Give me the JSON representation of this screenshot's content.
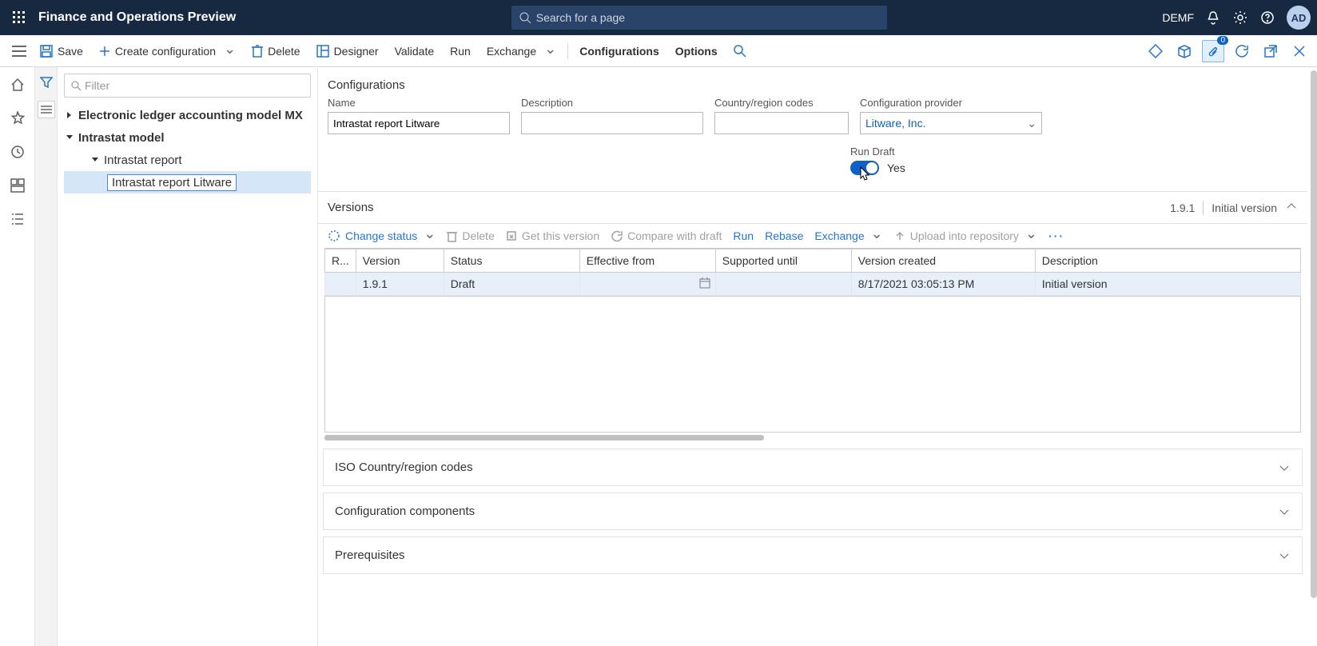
{
  "topbar": {
    "title": "Finance and Operations Preview",
    "search_placeholder": "Search for a page",
    "company": "DEMF",
    "avatar": "AD"
  },
  "actionbar": {
    "save": "Save",
    "create_config": "Create configuration",
    "delete": "Delete",
    "designer": "Designer",
    "validate": "Validate",
    "run": "Run",
    "exchange": "Exchange",
    "configurations": "Configurations",
    "options": "Options",
    "badge_count": "0"
  },
  "tree": {
    "filter_placeholder": "Filter",
    "items": [
      {
        "label": "Electronic ledger accounting model MX",
        "depth": 1,
        "bold": true,
        "twisty": "right"
      },
      {
        "label": "Intrastat model",
        "depth": 1,
        "bold": true,
        "twisty": "down"
      },
      {
        "label": "Intrastat report",
        "depth": 2,
        "twisty": "down"
      },
      {
        "label": "Intrastat report Litware",
        "depth": 3,
        "selected": true
      }
    ]
  },
  "form": {
    "section_title": "Configurations",
    "labels": {
      "name": "Name",
      "description": "Description",
      "country_codes": "Country/region codes",
      "provider": "Configuration provider",
      "run_draft": "Run Draft"
    },
    "values": {
      "name": "Intrastat report Litware",
      "description": "",
      "country_codes": "",
      "provider": "Litware, Inc.",
      "run_draft_state": "Yes"
    }
  },
  "versions": {
    "title": "Versions",
    "current": "1.9.1",
    "summary": "Initial version",
    "toolbar": {
      "change_status": "Change status",
      "delete": "Delete",
      "get_version": "Get this version",
      "compare": "Compare with draft",
      "run": "Run",
      "rebase": "Rebase",
      "exchange": "Exchange",
      "upload": "Upload into repository"
    },
    "columns": [
      "R...",
      "Version",
      "Status",
      "Effective from",
      "Supported until",
      "Version created",
      "Description"
    ],
    "rows": [
      {
        "r": "",
        "version": "1.9.1",
        "status": "Draft",
        "effective_from": "",
        "supported_until": "",
        "created": "8/17/2021 03:05:13 PM",
        "description": "Initial version"
      }
    ]
  },
  "expanders": {
    "iso": "ISO Country/region codes",
    "components": "Configuration components",
    "prerequisites": "Prerequisites"
  }
}
